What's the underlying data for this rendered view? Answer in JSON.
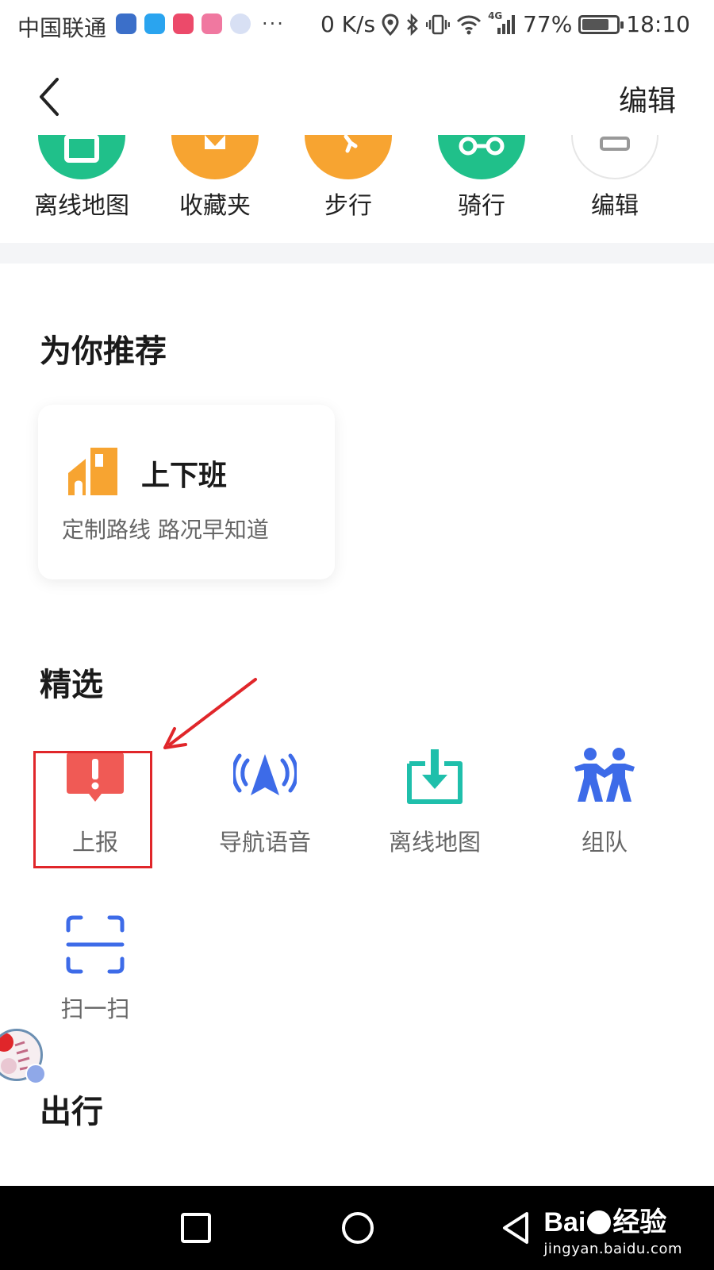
{
  "status_bar": {
    "carrier": "中国联通",
    "more": "···",
    "net_speed": "0 K/s",
    "signal_type": "4G",
    "battery_pct": "77%",
    "battery_level": 0.77,
    "time": "18:10"
  },
  "header": {
    "edit_label": "编辑"
  },
  "top_tools": [
    {
      "label": "离线地图",
      "color": "#20c08a"
    },
    {
      "label": "收藏夹",
      "color": "#f7a431"
    },
    {
      "label": "步行",
      "color": "#f7a431"
    },
    {
      "label": "骑行",
      "color": "#20c08a"
    },
    {
      "label": "编辑",
      "color": "#ffffff"
    }
  ],
  "recommend": {
    "title": "为你推荐",
    "card_title": "上下班",
    "card_subtitle": "定制路线 路况早知道",
    "card_icon_color": "#f7a431"
  },
  "featured": {
    "title": "精选",
    "items": [
      {
        "label": "上报",
        "icon": "report-icon",
        "color": "#f05a55"
      },
      {
        "label": "导航语音",
        "icon": "navigation-voice-icon",
        "color": "#3d6be8"
      },
      {
        "label": "离线地图",
        "icon": "offline-map-download-icon",
        "color": "#1fbfab"
      },
      {
        "label": "组队",
        "icon": "team-icon",
        "color": "#3d6be8"
      },
      {
        "label": "扫一扫",
        "icon": "scan-icon",
        "color": "#3d6be8"
      }
    ]
  },
  "travel": {
    "title": "出行"
  },
  "annotation": {
    "color": "#e0262a"
  },
  "watermark": {
    "brand": "Bai",
    "suffix": "经验",
    "url": "jingyan.baidu.com"
  }
}
